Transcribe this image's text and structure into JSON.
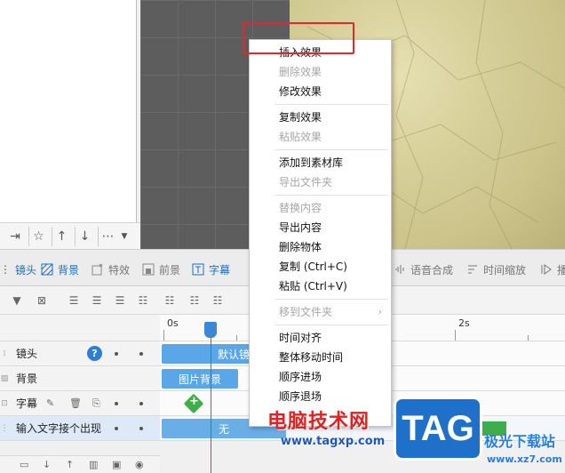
{
  "left_toolbar": {
    "icons": [
      "export-icon",
      "star-icon",
      "arrow-up-icon",
      "arrow-down-icon",
      "more-icon",
      "dropdown-arrow-icon"
    ]
  },
  "tabs": [
    {
      "label": "镜头",
      "icon": "camera-icon",
      "active": true
    },
    {
      "label": "背景",
      "icon": "background-icon",
      "active": true
    },
    {
      "label": "特效",
      "icon": "effect-icon",
      "active": false
    },
    {
      "label": "前景",
      "icon": "foreground-icon",
      "active": false
    },
    {
      "label": "字幕",
      "icon": "subtitle-icon",
      "active": true
    },
    {
      "label": "语音合成",
      "icon": "voice-icon",
      "active": false
    },
    {
      "label": "时间缩放",
      "icon": "time-scale-icon",
      "active": false
    },
    {
      "label": "播",
      "icon": "play-icon",
      "active": false
    }
  ],
  "ruler": {
    "labels": [
      "0s",
      "2s"
    ]
  },
  "tracks": [
    {
      "name": "镜头",
      "clip": "默认镜",
      "help": "?"
    },
    {
      "name": "背景",
      "clip": "图片背景"
    },
    {
      "name": "字幕",
      "clip": ""
    },
    {
      "name": "输入文字接个出现",
      "clip": "无"
    }
  ],
  "context_menu": {
    "groups": [
      [
        {
          "label": "插入效果",
          "enabled": true
        },
        {
          "label": "删除效果",
          "enabled": false
        },
        {
          "label": "修改效果",
          "enabled": true
        }
      ],
      [
        {
          "label": "复制效果",
          "enabled": true
        },
        {
          "label": "粘贴效果",
          "enabled": false
        }
      ],
      [
        {
          "label": "添加到素材库",
          "enabled": true
        },
        {
          "label": "导出文件夹",
          "enabled": false
        }
      ],
      [
        {
          "label": "替换内容",
          "enabled": false
        },
        {
          "label": "导出内容",
          "enabled": true
        },
        {
          "label": "删除物体",
          "enabled": true
        },
        {
          "label": "复制 (Ctrl+C)",
          "enabled": true
        },
        {
          "label": "粘贴 (Ctrl+V)",
          "enabled": true
        }
      ],
      [
        {
          "label": "移到文件夹",
          "enabled": false,
          "submenu": true
        }
      ],
      [
        {
          "label": "时间对齐",
          "enabled": true
        },
        {
          "label": "整体移动时间",
          "enabled": true
        },
        {
          "label": "顺序进场",
          "enabled": true
        },
        {
          "label": "顺序退场",
          "enabled": true
        }
      ]
    ]
  },
  "watermarks": {
    "site_name": "电脑技术网",
    "site_url": "www.tagxp.com",
    "logo": "TAG",
    "download_site": "极光下载站",
    "download_url": "www.xz7.com"
  },
  "colors": {
    "highlight": "#e02a2a",
    "accent": "#1c6fc1",
    "playhead": "#e03a3a",
    "clip": "#5aa6e6"
  }
}
